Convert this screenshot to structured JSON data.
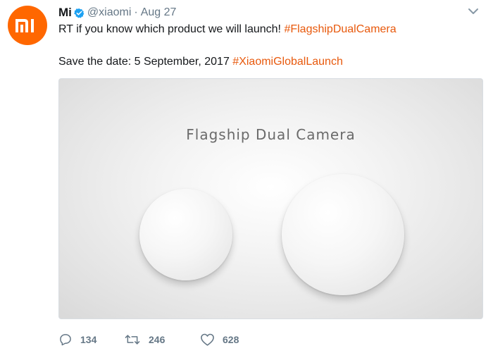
{
  "tweet": {
    "avatar_text": "mi",
    "name": "Mi",
    "handle": "@xiaomi",
    "separator": "·",
    "date": "Aug 27",
    "line1_text": "RT if you know which product we will launch! ",
    "line1_hashtag": "#FlagshipDualCamera",
    "line2_text": "Save the date: 5 September, 2017 ",
    "line2_hashtag": "#XiaomiGlobalLaunch",
    "media_title": "Flagship Dual Camera",
    "reply_count": "134",
    "retweet_count": "246",
    "like_count": "628"
  },
  "colors": {
    "brand": "#ff6700",
    "hashtag": "#e8590c",
    "verified": "#1da1f2",
    "muted": "#657786"
  },
  "icons": {
    "verified": "verified-badge-icon",
    "caret": "chevron-down-icon",
    "reply": "reply-bubble-icon",
    "retweet": "retweet-icon",
    "like": "heart-icon"
  }
}
